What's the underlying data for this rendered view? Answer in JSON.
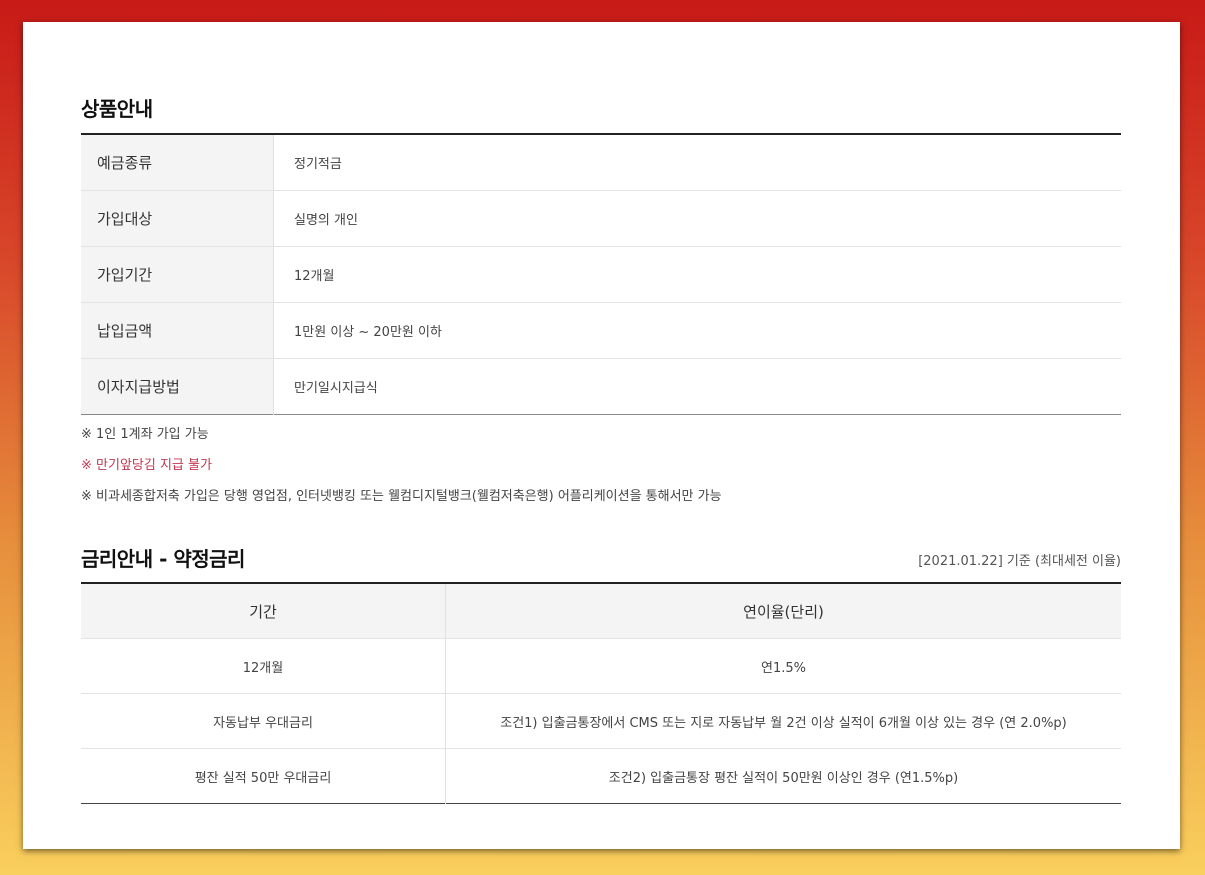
{
  "product_info": {
    "title": "상품안내",
    "rows": [
      {
        "label": "예금종류",
        "value": "정기적금"
      },
      {
        "label": "가입대상",
        "value": "실명의 개인"
      },
      {
        "label": "가입기간",
        "value": "12개월"
      },
      {
        "label": "납입금액",
        "value": "1만원 이상 ~ 20만원 이하"
      },
      {
        "label": "이자지급방법",
        "value": "만기일시지급식"
      }
    ],
    "notes": [
      "※ 1인 1계좌 가입 가능",
      "※ 만기앞당김 지급 불가",
      "※ 비과세종합저축 가입은 당행 영업점, 인터넷뱅킹 또는 웰컴디지털뱅크(웰컴저축은행) 어플리케이션을 통해서만 가능"
    ],
    "highlight_color": "#c2384f"
  },
  "rate_info": {
    "title": "금리안내 - 약정금리",
    "base_date": "[2021.01.22] 기준 (최대세전 이율)",
    "headers": [
      "기간",
      "연이율(단리)"
    ],
    "rows": [
      {
        "period": "12개월",
        "rate": "연1.5%"
      },
      {
        "period": "자동납부 우대금리",
        "rate": "조건1) 입출금통장에서 CMS 또는 지로 자동납부 월 2건 이상 실적이 6개월 이상 있는 경우 (연 2.0%p)"
      },
      {
        "period": "평잔 실적 50만 우대금리",
        "rate": "조건2) 입출금통장 평잔 실적이 50만원 이상인 경우 (연1.5%p)"
      }
    ]
  }
}
